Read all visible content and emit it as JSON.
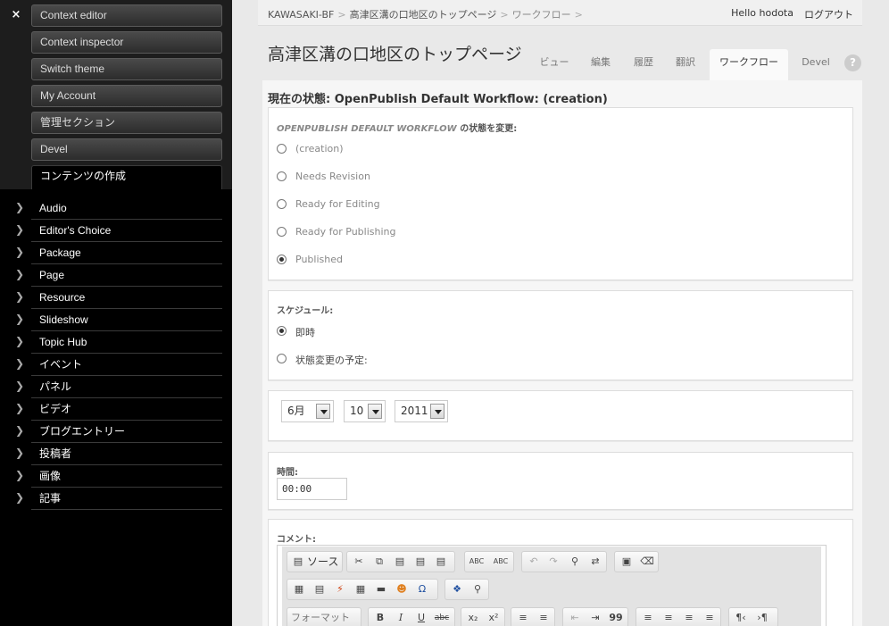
{
  "admin_menu": {
    "close_glyph": "×",
    "top_items": [
      "Context editor",
      "Context inspector",
      "Switch theme",
      "My Account",
      "管理セクション",
      "Devel",
      "コンテンツの作成"
    ],
    "content_types": [
      "Audio",
      "Editor's Choice",
      "Package",
      "Page",
      "Resource",
      "Slideshow",
      "Topic Hub",
      "イベント",
      "パネル",
      "ビデオ",
      "ブログエントリー",
      "投稿者",
      "画像",
      "記事"
    ]
  },
  "header": {
    "breadcrumbs": [
      "KAWASAKI-BF",
      "高津区溝の口地区のトップページ",
      "ワークフロー"
    ],
    "separator": ">",
    "greeting": "Hello hodota",
    "logout": "ログアウト"
  },
  "page": {
    "title": "高津区溝の口地区のトップページ",
    "tabs": [
      "ビュー",
      "編集",
      "履歴",
      "翻訳",
      "ワークフロー",
      "Devel"
    ],
    "active_tab": "ワークフロー",
    "help": "?"
  },
  "workflow": {
    "current_state_label": "現在の状態: OpenPublish Default Workflow: (creation)",
    "change_legend_em": "OPENPUBLISH DEFAULT WORKFLOW",
    "change_legend_rest": " の状態を変更:",
    "states": [
      "(creation)",
      "Needs Revision",
      "Ready for Editing",
      "Ready for Publishing",
      "Published"
    ],
    "selected_state": "Published"
  },
  "schedule": {
    "legend": "スケジュール:",
    "options": [
      "即時",
      "状態変更の予定:"
    ],
    "selected": "即時",
    "month": "6月",
    "day": "10",
    "year": "2011",
    "time_label": "時間:",
    "time_value": "00:00"
  },
  "comment": {
    "label": "コメント:",
    "toolbar": {
      "source_label": "ソース",
      "format_label": "フォーマット",
      "spell_icon_1": "ABC",
      "spell_icon_2": "ABC",
      "omega": "Ω",
      "bold": "B",
      "italic": "I",
      "underline": "U",
      "strike": "abc",
      "subscript": "x₂",
      "superscript": "x²",
      "quote": "99",
      "pilcrow_ltr": "¶‹",
      "pilcrow_rtl": "›¶"
    }
  }
}
